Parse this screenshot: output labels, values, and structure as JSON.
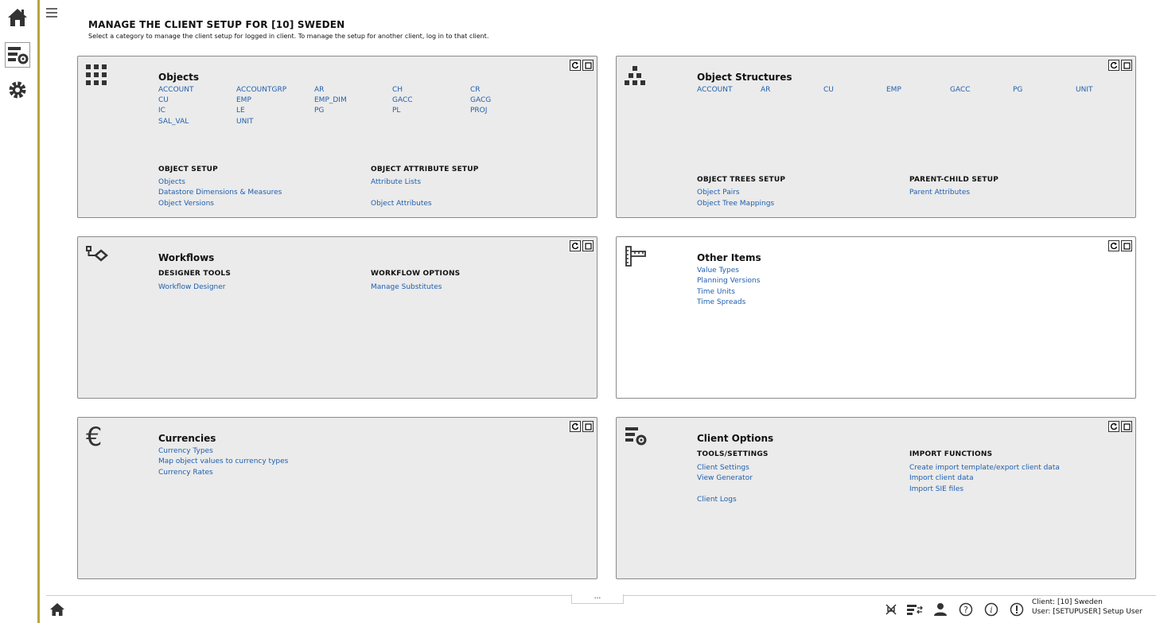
{
  "page": {
    "title": "MANAGE THE CLIENT SETUP FOR [10] SWEDEN",
    "subtitle": "Select a category to manage the client setup for logged in client. To manage the setup for another client, log in to that client."
  },
  "leftbar": {
    "icons": [
      "home-icon",
      "client-setup-icon",
      "settings-gear-icon"
    ]
  },
  "panels": {
    "objects": {
      "title": "Objects",
      "icon": "grid-icon",
      "codes": [
        "ACCOUNT",
        "ACCOUNTGRP",
        "AR",
        "CH",
        "CR",
        "CU",
        "EMP",
        "EMP_DIM",
        "GACC",
        "GACG",
        "IC",
        "LE",
        "PG",
        "PL",
        "PROJ",
        "SAL_VAL",
        "UNIT"
      ],
      "setup_header": "OBJECT SETUP",
      "setup_links": [
        "Objects",
        "Datastore Dimensions & Measures",
        "Object Versions"
      ],
      "attr_header": "OBJECT ATTRIBUTE SETUP",
      "attr_links": [
        "Attribute Lists",
        "Object Attributes"
      ]
    },
    "structures": {
      "title": "Object Structures",
      "icon": "hierarchy-icon",
      "codes": [
        "ACCOUNT",
        "AR",
        "CU",
        "EMP",
        "GACC",
        "PG",
        "UNIT"
      ],
      "trees_header": "OBJECT TREES SETUP",
      "trees_links": [
        "Object Pairs",
        "Object Tree Mappings"
      ],
      "parent_header": "PARENT-CHILD SETUP",
      "parent_links": [
        "Parent Attributes"
      ]
    },
    "workflows": {
      "title": "Workflows",
      "icon": "workflow-icon",
      "designer_header": "DESIGNER TOOLS",
      "designer_links": [
        "Workflow Designer"
      ],
      "options_header": "WORKFLOW OPTIONS",
      "options_links": [
        "Manage Substitutes"
      ]
    },
    "other": {
      "title": "Other Items",
      "icon": "ruler-icon",
      "links": [
        "Value Types",
        "Planning Versions",
        "Time Units",
        "Time Spreads"
      ]
    },
    "currencies": {
      "title": "Currencies",
      "icon": "euro-icon",
      "symbol": "€",
      "links": [
        "Currency Types",
        "Map object values to currency types",
        "Currency Rates"
      ]
    },
    "client_options": {
      "title": "Client Options",
      "icon": "client-options-icon",
      "tools_header": "TOOLS/SETTINGS",
      "tools_links": [
        "Client Settings",
        "View Generator",
        "Client Logs"
      ],
      "import_header": "IMPORT FUNCTIONS",
      "import_links": [
        "Create import template/export client data",
        "Import client data",
        "Import SIE files"
      ]
    }
  },
  "footer": {
    "more": "...",
    "client": "Client: [10] Sweden",
    "user": "User: [SETUPUSER] Setup User"
  },
  "colors": {
    "accent": "#b5a73a",
    "link": "#1f5fae",
    "panel_bg": "#ebebeb"
  }
}
